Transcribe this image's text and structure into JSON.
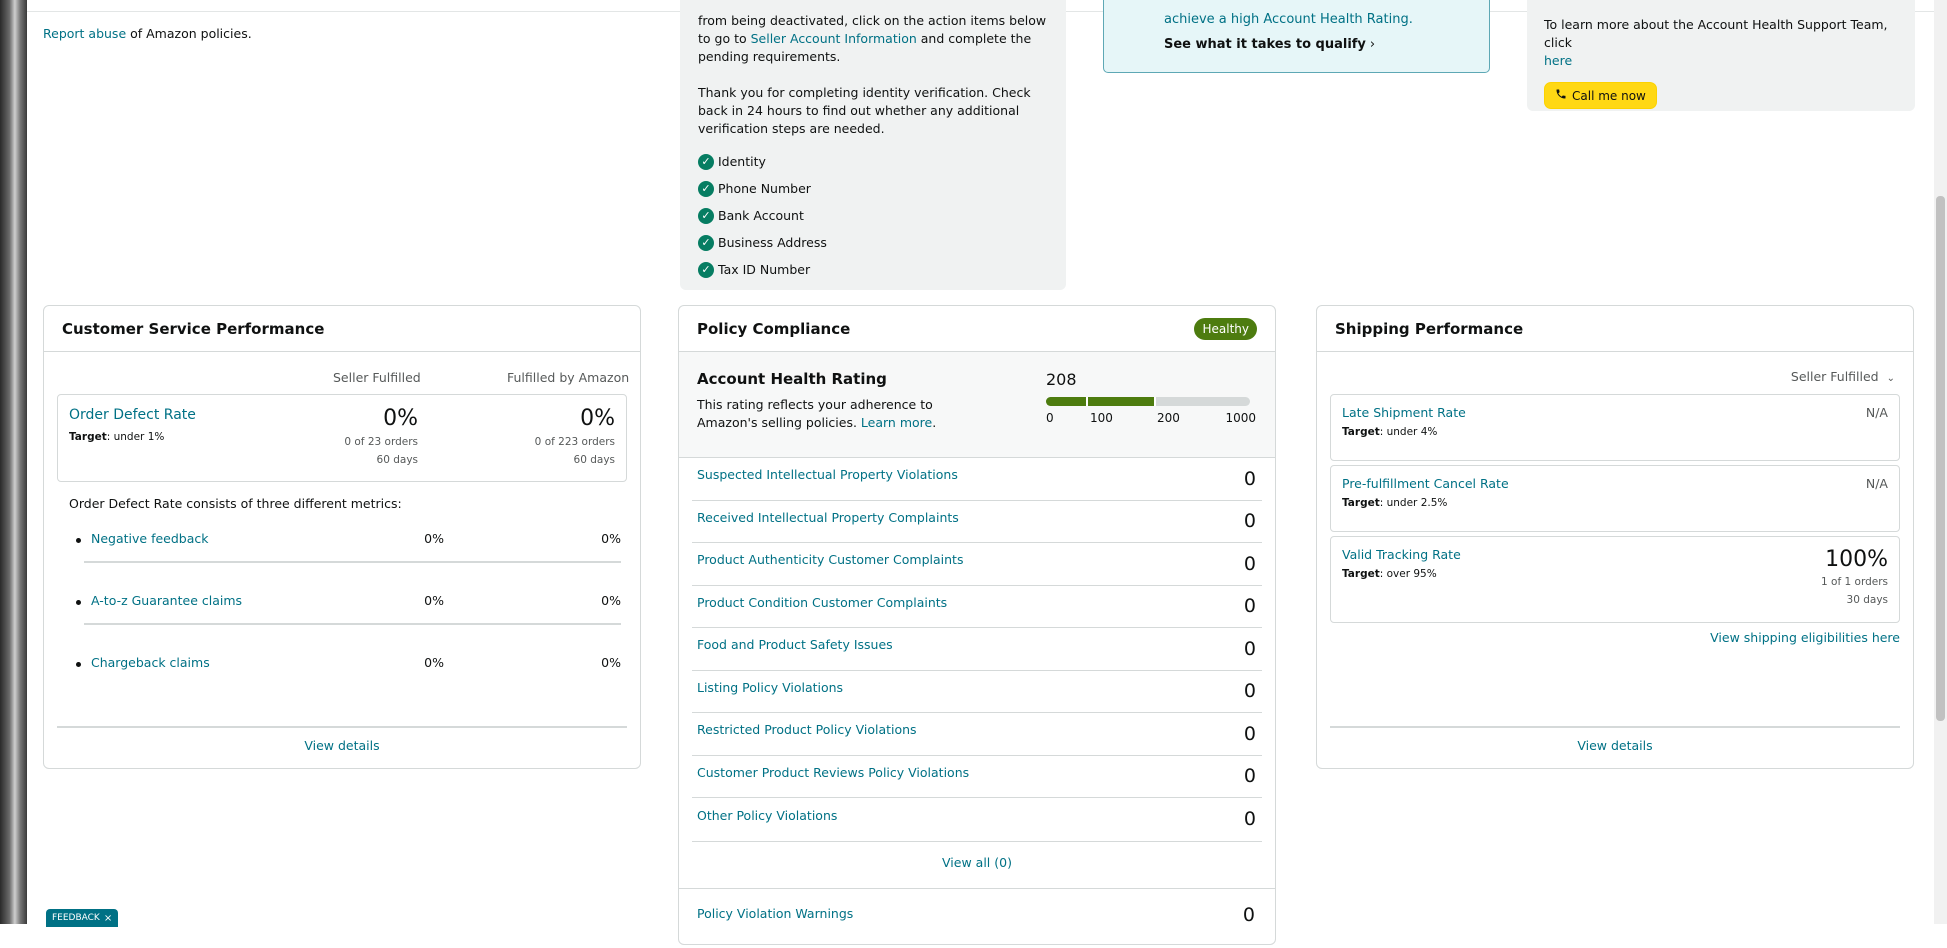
{
  "top_left": {
    "report_abuse_link": "Report abuse",
    "report_abuse_suffix": " of Amazon policies."
  },
  "verification": {
    "para1_a": "from being deactivated, click on the action items below to go to ",
    "para1_link": "Seller Account Information",
    "para1_b": " and complete the pending requirements.",
    "para2": "Thank you for completing identity verification. Check back in 24 hours to find out whether any additional verification steps are needed.",
    "items": [
      "Identity",
      "Phone Number",
      "Bank Account",
      "Business Address",
      "Tax ID Number"
    ]
  },
  "qualify": {
    "text": "achieve a high Account Health Rating.",
    "link": "See what it takes to qualify",
    "chevron": "›"
  },
  "support": {
    "text": "To learn more about the Account Health Support Team, click",
    "here_link": "here",
    "call_button": "Call me now"
  },
  "customer_service": {
    "title": "Customer Service Performance",
    "col_seller": "Seller Fulfilled",
    "col_fba": "Fulfilled by Amazon",
    "odr": {
      "title": "Order Defect Rate",
      "target_label": "Target",
      "target_value": ": under 1%",
      "seller_value": "0%",
      "seller_orders": "0 of 23 orders",
      "seller_days": "60 days",
      "fba_value": "0%",
      "fba_orders": "0 of 223 orders",
      "fba_days": "60 days"
    },
    "note": "Order Defect Rate consists of three different metrics:",
    "metrics": [
      {
        "label": "Negative feedback",
        "seller": "0%",
        "fba": "0%"
      },
      {
        "label": "A-to-z Guarantee claims",
        "seller": "0%",
        "fba": "0%"
      },
      {
        "label": "Chargeback claims",
        "seller": "0%",
        "fba": "0%"
      }
    ],
    "view_details": "View details"
  },
  "policy": {
    "title": "Policy Compliance",
    "badge": "Healthy",
    "badge_color": "#4d7c0f",
    "ahr": {
      "title": "Account Health Rating",
      "desc": "This rating reflects your adherence to Amazon's selling policies. ",
      "learn_more": "Learn more",
      "desc_end": ".",
      "score": "208",
      "score_value": 208,
      "ticks": [
        "0",
        "100",
        "200",
        "1000"
      ]
    },
    "violations": [
      {
        "label": "Suspected Intellectual Property Violations",
        "count": "0"
      },
      {
        "label": "Received Intellectual Property Complaints",
        "count": "0"
      },
      {
        "label": "Product Authenticity Customer Complaints",
        "count": "0"
      },
      {
        "label": "Product Condition Customer Complaints",
        "count": "0"
      },
      {
        "label": "Food and Product Safety Issues",
        "count": "0"
      },
      {
        "label": "Listing Policy Violations",
        "count": "0"
      },
      {
        "label": "Restricted Product Policy Violations",
        "count": "0"
      },
      {
        "label": "Customer Product Reviews Policy Violations",
        "count": "0"
      },
      {
        "label": "Other Policy Violations",
        "count": "0"
      }
    ],
    "view_all": "View all (0)",
    "warnings": {
      "label": "Policy Violation Warnings",
      "count": "0"
    }
  },
  "shipping": {
    "title": "Shipping Performance",
    "filter": "Seller Fulfilled",
    "filter_icon": "⌄",
    "metrics": [
      {
        "name": "Late Shipment Rate",
        "target_label": "Target",
        "target_value": ": under 4%",
        "value": "N/A"
      },
      {
        "name": "Pre-fulfillment Cancel Rate",
        "target_label": "Target",
        "target_value": ": under 2.5%",
        "value": "N/A"
      },
      {
        "name": "Valid Tracking Rate",
        "target_label": "Target",
        "target_value": ": over 95%",
        "value": "100%",
        "orders": "1 of 1 orders",
        "days": "30 days"
      }
    ],
    "eligibility_link": "View shipping eligibilities here",
    "view_details": "View details"
  },
  "feedback": {
    "label": "FEEDBACK",
    "close": "×"
  },
  "colors": {
    "link": "#007185",
    "accent_yellow": "#ffd814",
    "check_green": "#067d62"
  }
}
